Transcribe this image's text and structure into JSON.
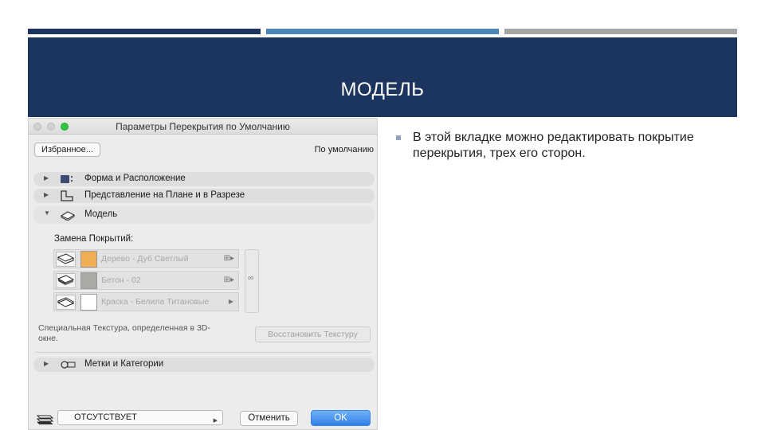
{
  "slide": {
    "title": "МОДЕЛЬ",
    "bullet": "В этой вкладке можно редактировать покрытие перекрытия, трех его сторон."
  },
  "dialog": {
    "title": "Параметры Перекрытия по Умолчанию",
    "favorites_label": "Избранное...",
    "default_label": "По умолчанию",
    "sections": {
      "geometry": "Форма и Расположение",
      "floor_plan": "Представление на Плане и в Разрезе",
      "model": "Модель",
      "tags": "Метки и Категории"
    },
    "surface_override_label": "Замена Покрытий:",
    "materials": [
      {
        "name": "Дерево - Дуб Светлый",
        "color": "#f0ad52"
      },
      {
        "name": "Бетон - 02",
        "color": "#aaaaa4"
      },
      {
        "name": "Краска - Белила Титановые",
        "color": "#ffffff"
      }
    ],
    "texture_note": "Специальная Текстура, определенная в 3D-окне.",
    "restore_texture_label": "Восстановить Текстуру",
    "layer_value": "ОТСУТСТВУЕТ",
    "cancel_label": "Отменить",
    "ok_label": "OK"
  },
  "colors": {
    "dark_blue": "#1c355e",
    "mid_blue": "#4a87b8",
    "gray": "#a5a5a5",
    "ok_button": "#2f7fe6"
  }
}
